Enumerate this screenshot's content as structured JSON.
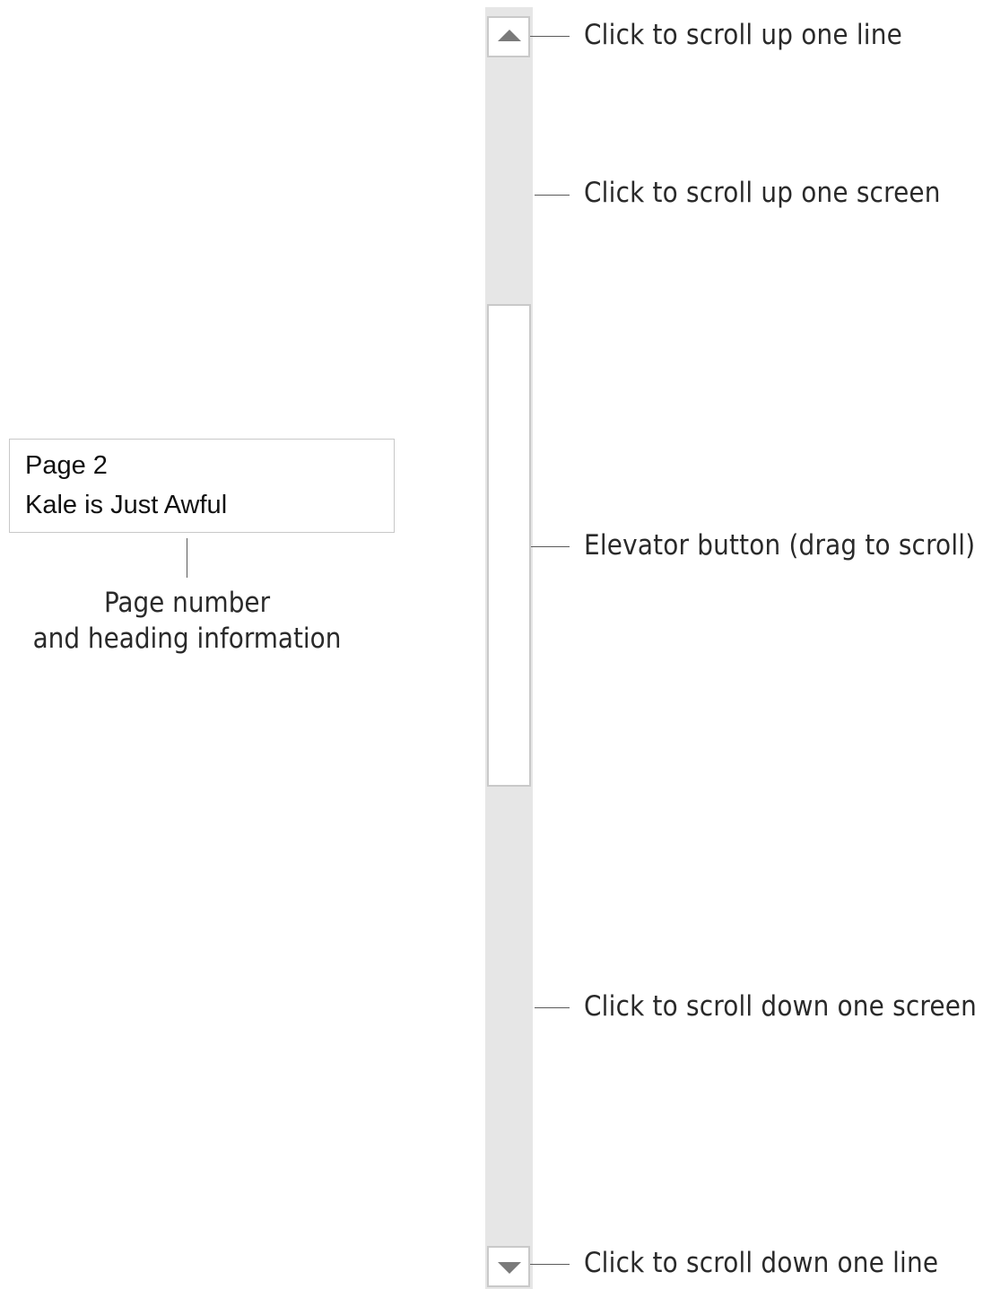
{
  "scrollbar": {
    "callouts": {
      "up_line": "Click to scroll up one line",
      "up_screen": "Click to scroll up one screen",
      "elevator": "Elevator button (drag to scroll)",
      "down_screen": "Click to scroll down one screen",
      "down_line": "Click to scroll down one line"
    },
    "icons": {
      "up": "arrow-up-icon",
      "down": "arrow-down-icon"
    }
  },
  "tooltip": {
    "page": "Page 2",
    "heading": "Kale is Just Awful",
    "caption_line1": "Page number",
    "caption_line2": "and heading information"
  },
  "colors": {
    "track": "#e6e6e6",
    "border": "#c9c9c9",
    "arrow": "#7a7a7a"
  }
}
